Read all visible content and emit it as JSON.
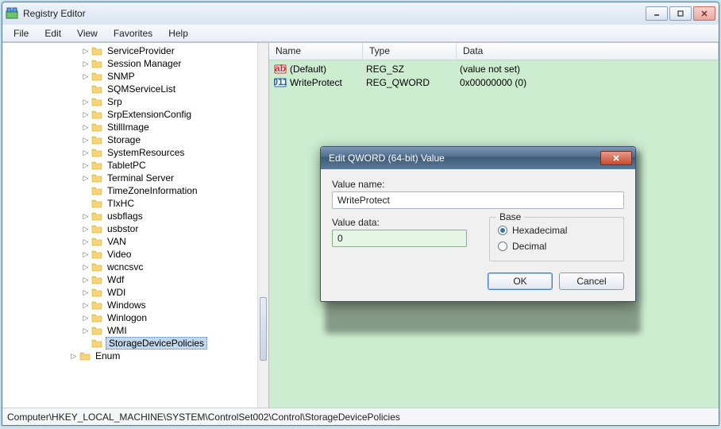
{
  "window": {
    "title": "Registry Editor"
  },
  "menu": {
    "file": "File",
    "edit": "Edit",
    "view": "View",
    "favorites": "Favorites",
    "help": "Help"
  },
  "tree": {
    "items": [
      {
        "label": "ServiceProvider",
        "expandable": true
      },
      {
        "label": "Session Manager",
        "expandable": true
      },
      {
        "label": "SNMP",
        "expandable": true
      },
      {
        "label": "SQMServiceList",
        "expandable": false
      },
      {
        "label": "Srp",
        "expandable": true
      },
      {
        "label": "SrpExtensionConfig",
        "expandable": true
      },
      {
        "label": "StillImage",
        "expandable": true
      },
      {
        "label": "Storage",
        "expandable": true
      },
      {
        "label": "SystemResources",
        "expandable": true
      },
      {
        "label": "TabletPC",
        "expandable": true
      },
      {
        "label": "Terminal Server",
        "expandable": true
      },
      {
        "label": "TimeZoneInformation",
        "expandable": false
      },
      {
        "label": "TIxHC",
        "expandable": false
      },
      {
        "label": "usbflags",
        "expandable": true
      },
      {
        "label": "usbstor",
        "expandable": true
      },
      {
        "label": "VAN",
        "expandable": true
      },
      {
        "label": "Video",
        "expandable": true
      },
      {
        "label": "wcncsvc",
        "expandable": true
      },
      {
        "label": "Wdf",
        "expandable": true
      },
      {
        "label": "WDI",
        "expandable": true
      },
      {
        "label": "Windows",
        "expandable": true
      },
      {
        "label": "Winlogon",
        "expandable": true
      },
      {
        "label": "WMI",
        "expandable": true
      },
      {
        "label": "StorageDevicePolicies",
        "expandable": false,
        "selected": true
      }
    ],
    "enum_label": "Enum"
  },
  "list": {
    "headers": {
      "name": "Name",
      "type": "Type",
      "data": "Data"
    },
    "rows": [
      {
        "icon": "string",
        "name": "(Default)",
        "type": "REG_SZ",
        "data": "(value not set)"
      },
      {
        "icon": "binary",
        "name": "WriteProtect",
        "type": "REG_QWORD",
        "data": "0x00000000 (0)"
      }
    ]
  },
  "dialog": {
    "title": "Edit QWORD (64-bit) Value",
    "value_name_label": "Value name:",
    "value_name": "WriteProtect",
    "value_data_label": "Value data:",
    "value_data": "0",
    "base_label": "Base",
    "hex_label": "Hexadecimal",
    "dec_label": "Decimal",
    "ok": "OK",
    "cancel": "Cancel"
  },
  "status": {
    "path": "Computer\\HKEY_LOCAL_MACHINE\\SYSTEM\\ControlSet002\\Control\\StorageDevicePolicies"
  }
}
